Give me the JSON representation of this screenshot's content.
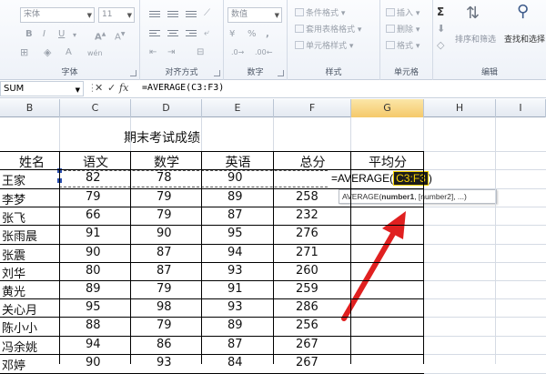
{
  "ribbon": {
    "font_group": {
      "label": "字体",
      "font_name": "宋体",
      "font_size": "11",
      "bold": "B",
      "italic": "I",
      "underline": "U",
      "font_color": "A",
      "wen": "wén"
    },
    "align_group": {
      "label": "对齐方式"
    },
    "number_group": {
      "label": "数字",
      "format": "数值",
      "percent": "%",
      "comma": ","
    },
    "styles_group": {
      "label": "样式",
      "items": [
        "条件格式",
        "套用表格格式",
        "单元格样式"
      ]
    },
    "cells_group": {
      "label": "单元格",
      "items": [
        "插入",
        "删除",
        "格式"
      ]
    },
    "edit_group": {
      "label": "编辑",
      "sigma": "Σ",
      "sort_filter": "排序和筛选",
      "find_select": "查找和选择"
    }
  },
  "formula_bar": {
    "name_box": "SUM",
    "cancel": "✕",
    "enter": "✓",
    "fx": "fx",
    "formula": "=AVERAGE(C3:F3)"
  },
  "columns": [
    "B",
    "C",
    "D",
    "E",
    "F",
    "G",
    "H",
    "I"
  ],
  "active_column": "G",
  "sheet": {
    "title": "期末考试成绩",
    "headers": [
      "姓名",
      "语文",
      "数学",
      "英语",
      "总分",
      "平均分"
    ],
    "rows": [
      [
        "王家",
        "82",
        "78",
        "90",
        ""
      ],
      [
        "李梦",
        "79",
        "79",
        "89",
        "258"
      ],
      [
        "张飞",
        "66",
        "79",
        "87",
        "232"
      ],
      [
        "张雨晨",
        "91",
        "90",
        "95",
        "276"
      ],
      [
        "张震",
        "90",
        "87",
        "94",
        "271"
      ],
      [
        "刘华",
        "80",
        "87",
        "93",
        "260"
      ],
      [
        "黄光",
        "89",
        "79",
        "91",
        "259"
      ],
      [
        "关心月",
        "95",
        "98",
        "93",
        "286"
      ],
      [
        "陈小小",
        "88",
        "79",
        "89",
        "256"
      ],
      [
        "冯余姚",
        "94",
        "86",
        "87",
        "267"
      ],
      [
        "邓婷",
        "90",
        "93",
        "84",
        "267"
      ]
    ],
    "editing_prefix": "=AVERAGE(",
    "editing_ref": "C3:F3",
    "editing_suffix": ")",
    "tooltip_func": "AVERAGE(",
    "tooltip_arg": "number1",
    "tooltip_rest": ", [number2], ...)"
  },
  "colors": {
    "arrow": "#e02020",
    "ref_highlight": "#f5d000",
    "active_header": "#f5c96a"
  }
}
